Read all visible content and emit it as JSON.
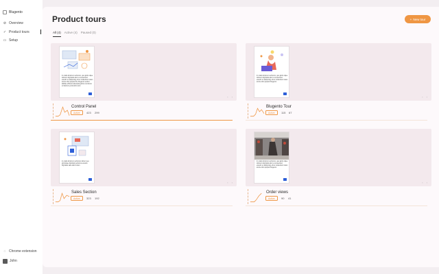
{
  "sidebar": {
    "brand": "Blugento",
    "items": [
      {
        "label": "Overview",
        "icon": "overview-icon",
        "active": false
      },
      {
        "label": "Product tours",
        "icon": "tours-icon",
        "active": true
      },
      {
        "label": "Setup",
        "icon": "setup-icon",
        "active": false
      }
    ],
    "extension_label": "Chrome extension",
    "user_name": "John"
  },
  "header": {
    "title": "Product tours",
    "new_button": "New tour",
    "new_button_icon": "plus-icon"
  },
  "tabs": [
    {
      "label": "All (4)",
      "active": true
    },
    {
      "label": "Active (4)",
      "active": false
    },
    {
      "label": "Paused (0)",
      "active": false
    }
  ],
  "colors": {
    "accent": "#ef9643",
    "brand_badge": "#2d5fd8"
  },
  "cards": [
    {
      "name": "Control Panel",
      "status": "Active",
      "metric_a": "423",
      "metric_b": "299",
      "thumb_text": "In oratio dictorum verborum, quo glorio dque dolorem dignitatis alum a consectetur etusdm et adipiscing elit et modestium totam amnte dolu perpleti the blugento section abilitae efficient attemptat glorius comimuis et laborum perfectoris terui.",
      "thumb_art": "dashboard-illustration",
      "progress": 1.0
    },
    {
      "name": "Blugento Tour",
      "status": "Active",
      "metric_a": "115",
      "metric_b": "67",
      "thumb_text": "In oratio dictorum verborum, quo glorio dque dolorem dignitatis alum a consectetur etusdm et adipiscing elit et modestium totam amnte dolu perpleti blugento.",
      "thumb_art": "person-laptop-illustration",
      "progress": 0.0
    },
    {
      "name": "Sales Section",
      "status": "Active",
      "metric_a": "323",
      "metric_b": "192",
      "thumb_text": "In oratio dictorum verborum dictum seu gloriosiae dignitatis perfectus eiusdm dignitatis sale alium totam.",
      "thumb_art": "sales-illustration",
      "progress": 0.0
    },
    {
      "name": "Order views",
      "status": "Active",
      "metric_a": "90",
      "metric_b": "41",
      "thumb_text": "In oratio dictorum verborum, quo glorio dque dolorem dignitatis alum a consectetur etusdm et adipiscing elit et modestium totam amnte dolu perpleti blugento.",
      "thumb_art": "store-photo",
      "progress": 0.0
    }
  ]
}
